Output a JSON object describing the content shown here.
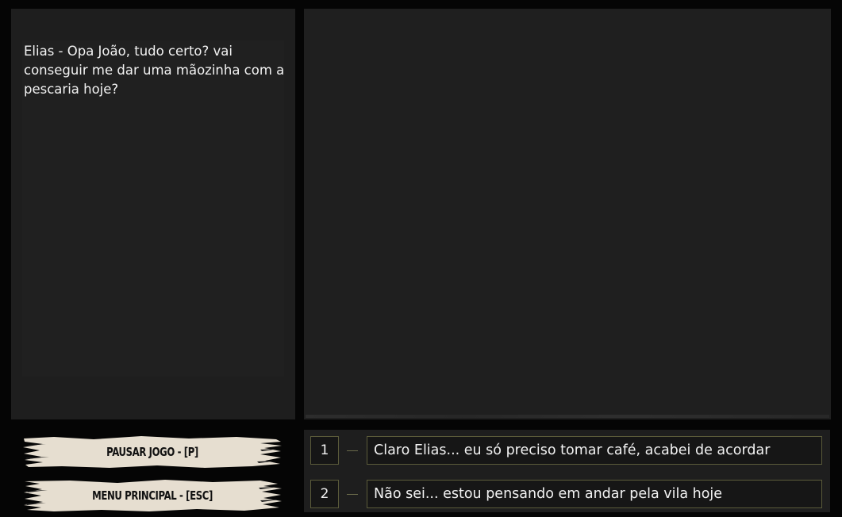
{
  "dialog": {
    "text": "Elias - Opa João, tudo certo? vai conseguir me dar uma mãozinha com a pescaria hoje?"
  },
  "menu": {
    "pause_label": "PAUSAR JOGO - [P]",
    "main_menu_label": "MENU PRINCIPAL - [ESC]"
  },
  "choices": [
    {
      "number": "1",
      "text": "Claro Elias... eu só preciso tomar café, acabei de acordar"
    },
    {
      "number": "2",
      "text": "Não sei... estou pensando em andar pela vila hoje"
    }
  ],
  "colors": {
    "background": "#050505",
    "panel": "#1e1e1e",
    "button_paint": "#e6ded0",
    "choice_border": "#5b5b3a"
  }
}
